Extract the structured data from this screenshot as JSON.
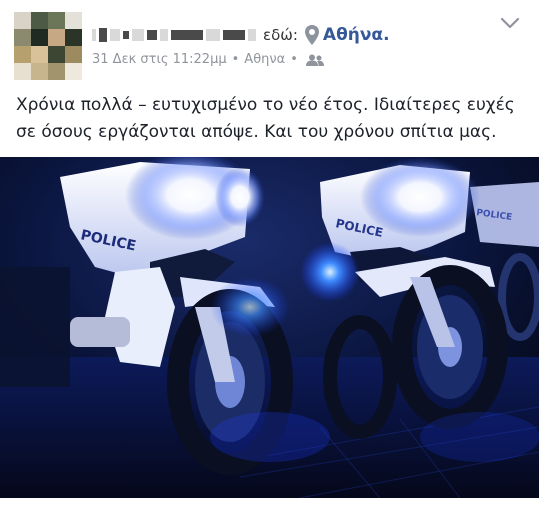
{
  "post": {
    "here_text": "εδώ:",
    "place": "Αθήνα.",
    "timestamp": "31 Δεκ στις 11:22μμ",
    "location": "Αθηνα",
    "body": "Χρόνια πολλά – ευτυχισμένο το νέο έτος. Ιδιαίτερες ευχές σε όσους εργάζονται απόψε. Και του χρόνου σπίτια μας.",
    "photo": {
      "left_label": "POLICE",
      "right_label": "POLICE",
      "far_right_label": "POLICE"
    }
  },
  "icons": {
    "pin": "location-pin-icon",
    "audience": "friends-audience-icon",
    "menu": "chevron-down-icon"
  },
  "colors": {
    "link": "#365899",
    "meta": "#90949c",
    "text": "#1d2129"
  }
}
